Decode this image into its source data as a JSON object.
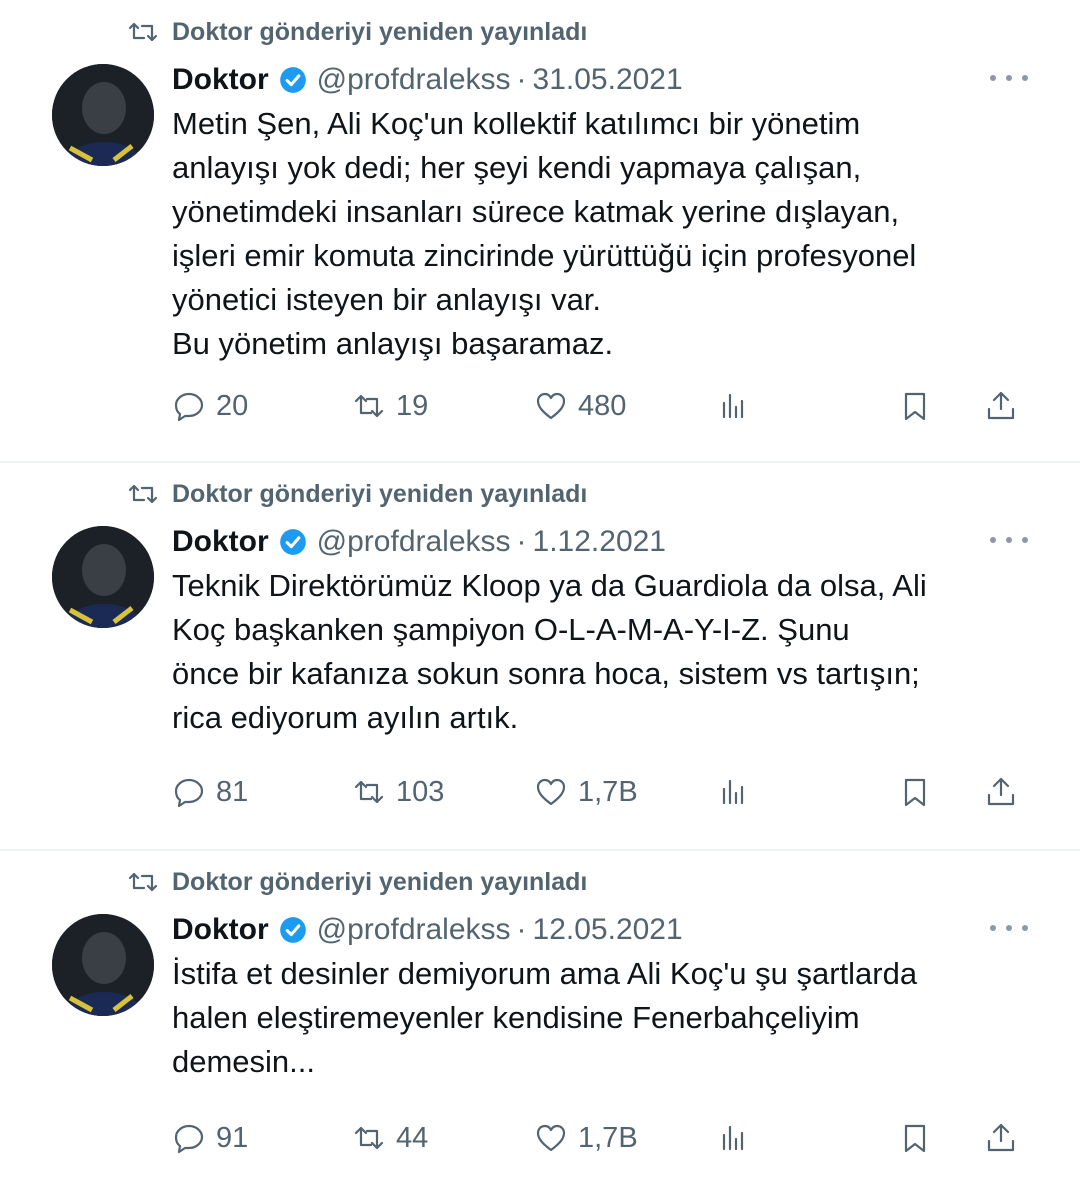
{
  "tweets": [
    {
      "repost_label": "Doktor gönderiyi yeniden yayınladı",
      "name": "Doktor",
      "handle": "@profdralekss",
      "separator": "·",
      "date": "31.05.2021",
      "lines": [
        "Metin Şen, Ali Koç'un kollektif katılımcı bir yönetim",
        "anlayışı yok dedi; her şeyi kendi yapmaya çalışan,",
        "yönetimdeki insanları sürece katmak yerine dışlayan,",
        "işleri emir komuta zincirinde yürüttüğü için profesyonel",
        "yönetici isteyen bir anlayışı var.",
        "Bu yönetim anlayışı başaramaz."
      ],
      "replies": "20",
      "reposts": "19",
      "likes": "480"
    },
    {
      "repost_label": "Doktor gönderiyi yeniden yayınladı",
      "name": "Doktor",
      "handle": "@profdralekss",
      "separator": "·",
      "date": "1.12.2021",
      "lines": [
        "Teknik Direktörümüz Kloop ya da Guardiola da olsa, Ali",
        "Koç başkanken şampiyon O-L-A-M-A-Y-I-Z. Şunu",
        "önce bir kafanıza sokun sonra hoca, sistem vs tartışın;",
        "rica ediyorum ayılın artık."
      ],
      "replies": "81",
      "reposts": "103",
      "likes": "1,7B"
    },
    {
      "repost_label": "Doktor gönderiyi yeniden yayınladı",
      "name": "Doktor",
      "handle": "@profdralekss",
      "separator": "·",
      "date": "12.05.2021",
      "lines": [
        "İstifa et desinler demiyorum ama Ali Koç'u şu şartlarda",
        "halen eleştiremeyenler kendisine Fenerbahçeliyim",
        "demesin..."
      ],
      "replies": "91",
      "reposts": "44",
      "likes": "1,7B"
    }
  ],
  "colors": {
    "text": "#0f1419",
    "muted": "#536471",
    "verified": "#1d9bf0",
    "separator": "#eff3f4"
  },
  "icons": [
    "repost-icon",
    "verified-badge-icon",
    "more-icon",
    "reply-icon",
    "retweet-icon",
    "like-icon",
    "views-icon",
    "bookmark-icon",
    "share-icon"
  ]
}
